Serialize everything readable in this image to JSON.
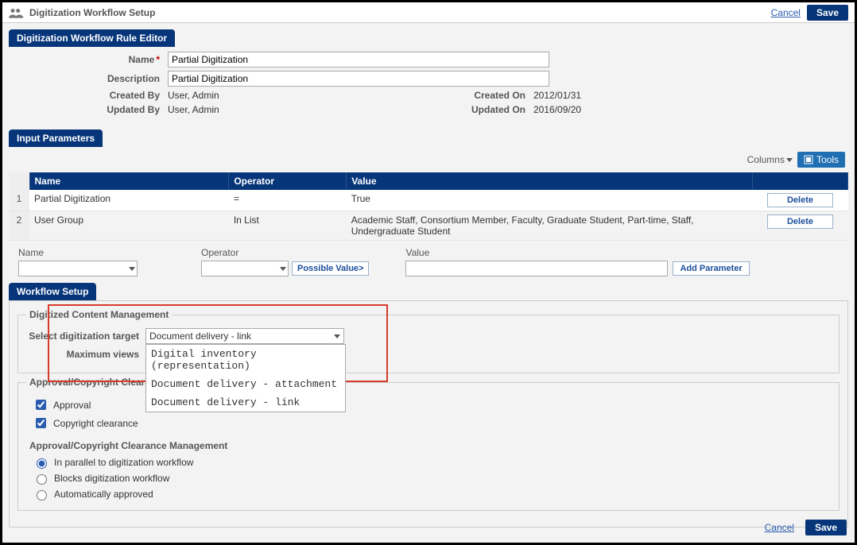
{
  "header": {
    "title": "Digitization Workflow Setup",
    "cancel": "Cancel",
    "save": "Save"
  },
  "editor": {
    "panel_title": "Digitization Workflow Rule Editor",
    "labels": {
      "name": "Name",
      "description": "Description",
      "created_by": "Created By",
      "updated_by": "Updated By",
      "created_on": "Created On",
      "updated_on": "Updated On"
    },
    "values": {
      "name": "Partial Digitization",
      "description": "Partial Digitization",
      "created_by": "User, Admin",
      "updated_by": "User, Admin",
      "created_on": "2012/01/31",
      "updated_on": "2016/09/20"
    }
  },
  "params": {
    "panel_title": "Input Parameters",
    "columns_btn": "Columns",
    "tools_btn": "Tools",
    "headers": {
      "name": "Name",
      "operator": "Operator",
      "value": "Value"
    },
    "rows": [
      {
        "num": "1",
        "name": "Partial Digitization",
        "operator": "=",
        "value": "True",
        "delete": "Delete"
      },
      {
        "num": "2",
        "name": "User Group",
        "operator": "In List",
        "value": "Academic Staff, Consortium Member, Faculty, Graduate Student, Part-time, Staff, Undergraduate Student",
        "delete": "Delete"
      }
    ],
    "add": {
      "name_label": "Name",
      "operator_label": "Operator",
      "possible_value": "Possible Value>",
      "value_label": "Value",
      "add_btn": "Add Parameter"
    }
  },
  "workflow": {
    "panel_title": "Workflow Setup",
    "digitized_legend": "Digitized Content Management",
    "target_label": "Select digitization target",
    "target_selected": "Document delivery - link",
    "target_options": [
      "Digital inventory (representation)",
      "Document delivery - attachment",
      "Document delivery - link"
    ],
    "max_views_label": "Maximum views",
    "approval_legend": "Approval/Copyright Clearance Processing",
    "approval_cb": "Approval",
    "copyright_cb": "Copyright clearance",
    "mgmt_heading": "Approval/Copyright Clearance Management",
    "mgmt_options": {
      "parallel": "In parallel to digitization workflow",
      "blocks": "Blocks digitization workflow",
      "auto": "Automatically approved"
    }
  },
  "footer": {
    "cancel": "Cancel",
    "save": "Save"
  }
}
